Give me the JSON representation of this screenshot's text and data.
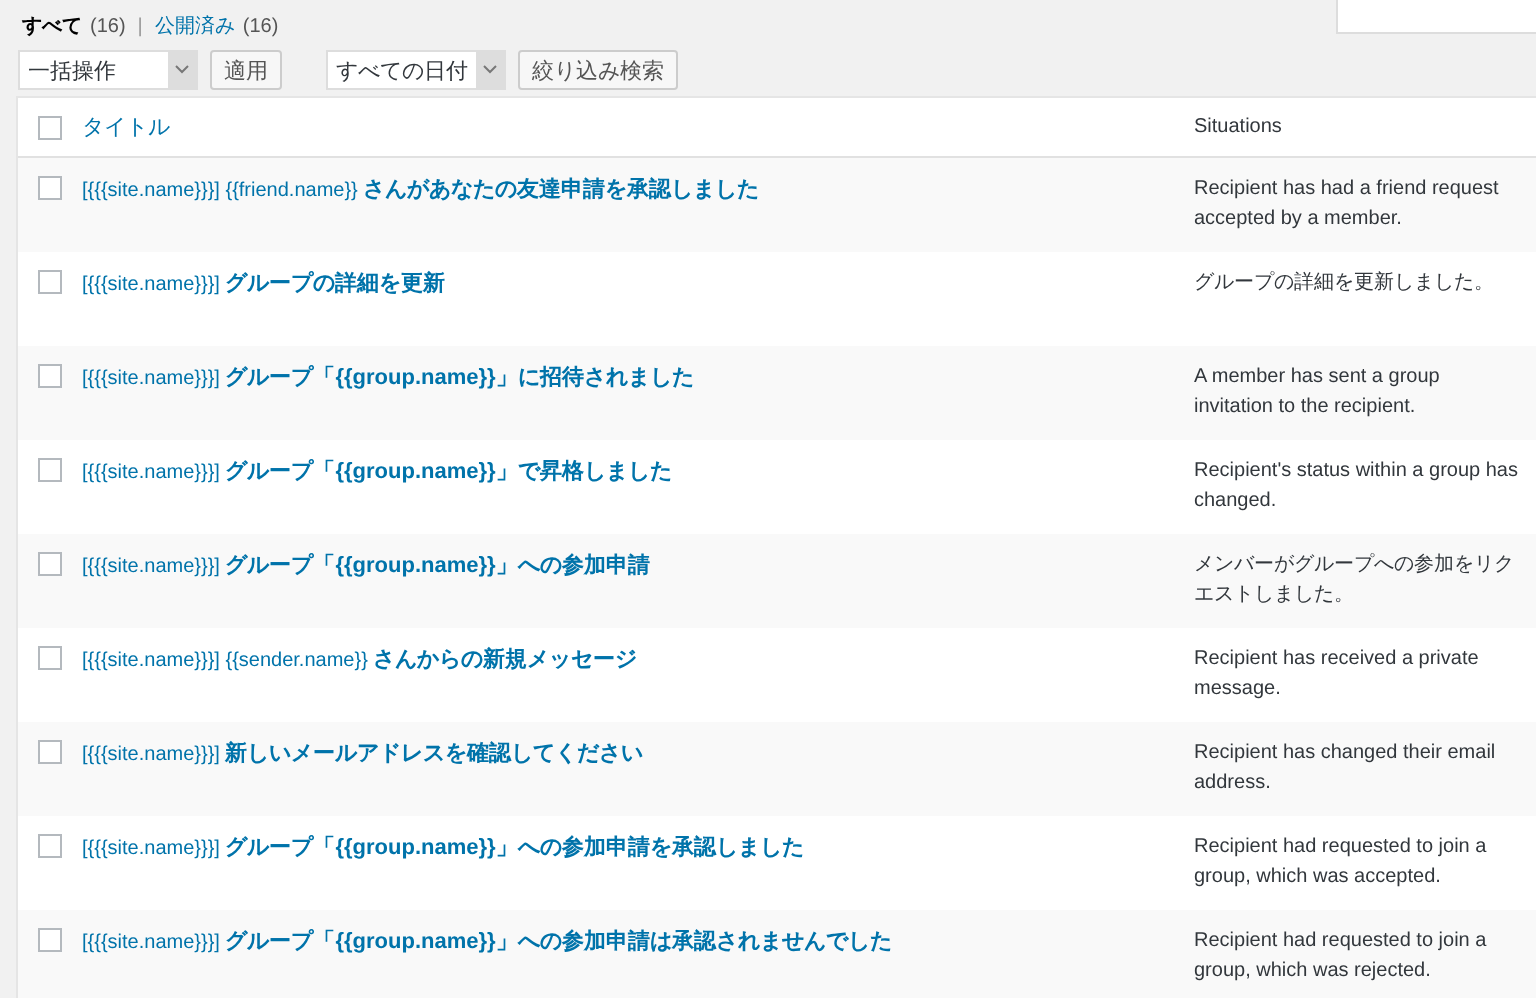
{
  "views": [
    {
      "label": "すべて",
      "count": "(16)",
      "selected": true
    },
    {
      "label": "公開済み",
      "count": "(16)",
      "selected": false
    }
  ],
  "view_separator": "|",
  "search": {
    "kind": "field"
  },
  "bulk_action": {
    "value": "一括操作",
    "button": "適用"
  },
  "date_filter": {
    "value": "すべての日付",
    "button": "絞り込み検索"
  },
  "table": {
    "columns": [
      "タイトル",
      "Situations"
    ],
    "header_checked": false,
    "rows": [
      {
        "title": "[{{{site.name}}}] {{friend.name}} **さんがあなたの友達申請を承認しました**",
        "situation": "Recipient has had a friend request accepted by a member.",
        "checked": false
      },
      {
        "title": "[{{{site.name}}}] **グループの詳細を更新**",
        "situation": "グループの詳細を更新しました。",
        "checked": false
      },
      {
        "title": "[{{{site.name}}}] **グループ「{{group.name}}」に招待されました**",
        "situation": "A member has sent a group invitation to the recipient.",
        "checked": false
      },
      {
        "title": "[{{{site.name}}}] **グループ「{{group.name}}」で昇格しました**",
        "situation": "Recipient's status within a group has changed.",
        "checked": false
      },
      {
        "title": "[{{{site.name}}}] **グループ「{{group.name}}」への参加申請**",
        "situation": "メンバーがグループへの参加をリクエストしました。",
        "checked": false
      },
      {
        "title": "[{{{site.name}}}] {{sender.name}} **さんからの新規メッセージ**",
        "situation": "Recipient has received a private message.",
        "checked": false
      },
      {
        "title": "[{{{site.name}}}] **新しいメールアドレスを確認してください**",
        "situation": "Recipient has changed their email address.",
        "checked": false
      },
      {
        "title": "[{{{site.name}}}] **グループ「{{group.name}}」への参加申請を承認しました**",
        "situation": "Recipient had requested to join a group, which was accepted.",
        "checked": false
      },
      {
        "title": "[{{{site.name}}}] **グループ「{{group.name}}」への参加申請は承認されませんでした**",
        "situation": "Recipient had requested to join a group, which was rejected.",
        "checked": false
      }
    ]
  }
}
